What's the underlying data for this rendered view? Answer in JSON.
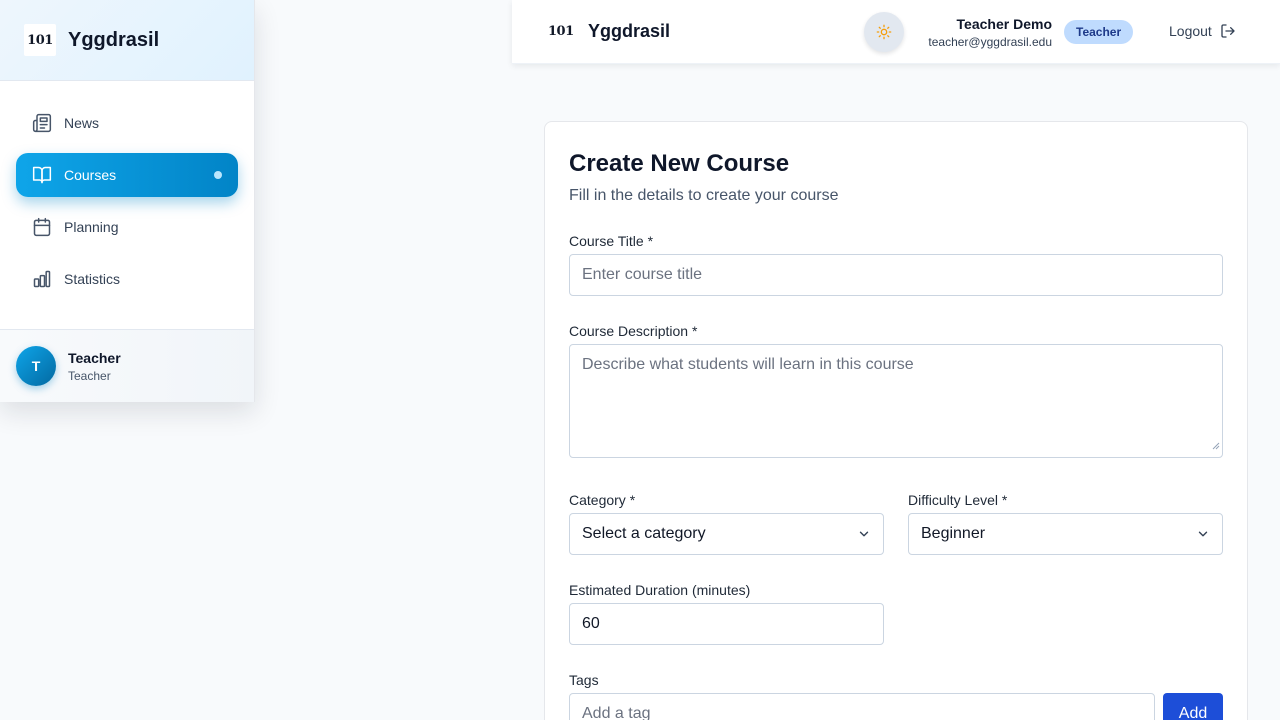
{
  "sidebar": {
    "logo_text": "101",
    "app_name": "Yggdrasil",
    "items": [
      {
        "label": "News",
        "icon": "newspaper-icon"
      },
      {
        "label": "Courses",
        "icon": "book-open-icon",
        "active": true
      },
      {
        "label": "Planning",
        "icon": "calendar-icon"
      },
      {
        "label": "Statistics",
        "icon": "bar-chart-icon"
      }
    ],
    "footer": {
      "avatar_initial": "T",
      "name": "Teacher",
      "role": "Teacher"
    }
  },
  "topbar": {
    "logo_text": "101",
    "app_name": "Yggdrasil",
    "theme_icon": "sun-icon",
    "user_name": "Teacher Demo",
    "user_email": "teacher@yggdrasil.edu",
    "role_badge": "Teacher",
    "logout_label": "Logout"
  },
  "form": {
    "title": "Create New Course",
    "subtitle": "Fill in the details to create your course",
    "course_title": {
      "label": "Course Title *",
      "placeholder": "Enter course title",
      "value": ""
    },
    "description": {
      "label": "Course Description *",
      "placeholder": "Describe what students will learn in this course",
      "value": ""
    },
    "category": {
      "label": "Category *",
      "value": "Select a category"
    },
    "difficulty": {
      "label": "Difficulty Level *",
      "value": "Beginner"
    },
    "duration": {
      "label": "Estimated Duration (minutes)",
      "value": "60"
    },
    "tags": {
      "label": "Tags",
      "placeholder": "Add a tag",
      "add_label": "Add"
    }
  },
  "colors": {
    "accent": "#0ea5e9",
    "accent_dark": "#0284c7",
    "primary_button": "#1d4ed8",
    "badge_bg": "#bfdbfe",
    "sun": "#f59e0b"
  }
}
